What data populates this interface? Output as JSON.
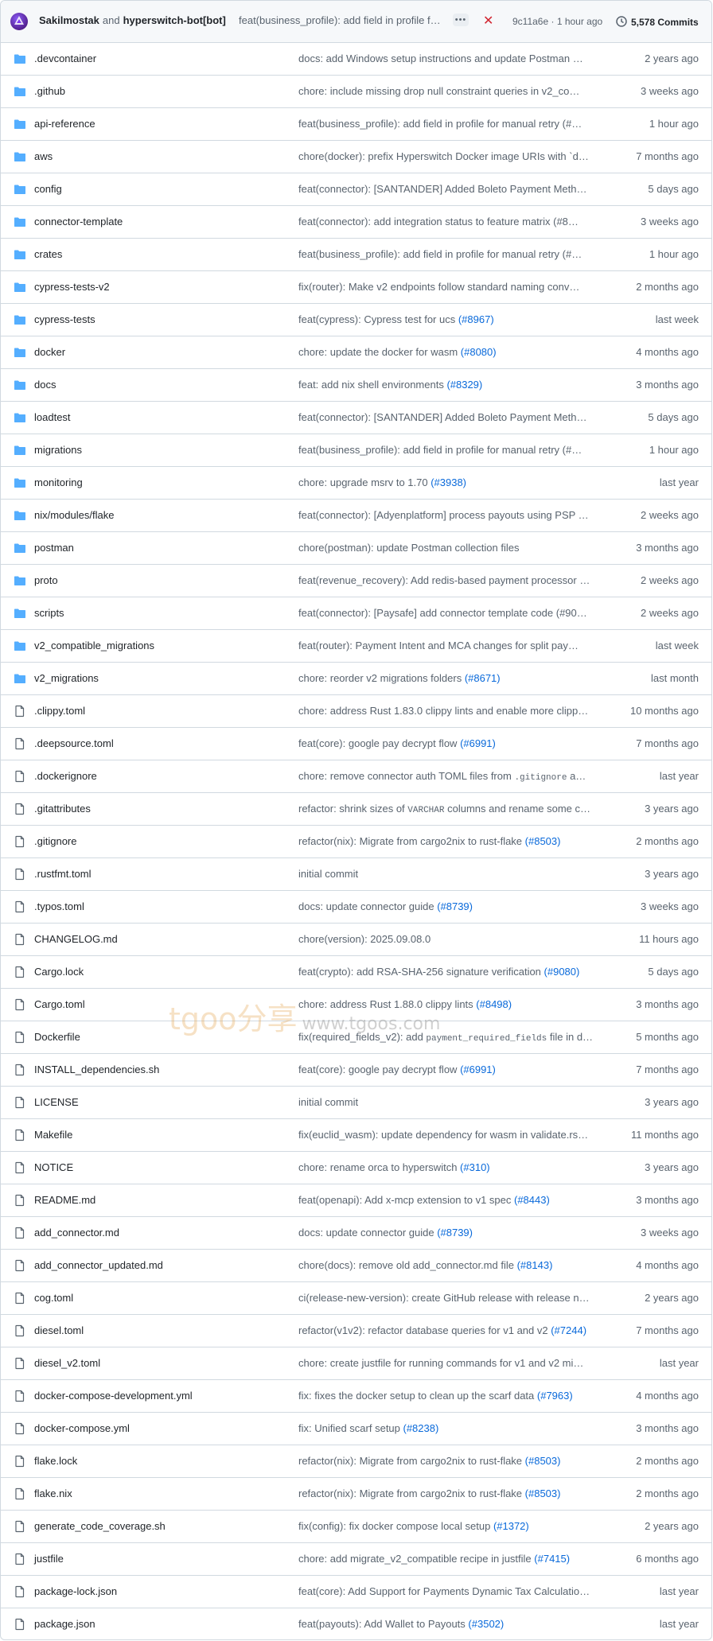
{
  "commit": {
    "author1": "Sakilmostak",
    "conjunction": "and",
    "author2": "hyperswitch-bot[bot]",
    "message": "feat(business_profile): add field in profile for manual retry",
    "dots": "•••",
    "status_icon": "x-icon",
    "status_color": "#d1242f",
    "sha_time": "9c11a6e · 1 hour ago",
    "commits_label": "5,578 Commits"
  },
  "watermark": {
    "text": "tgoo分享",
    "url": "www.tgoos.com"
  },
  "files": [
    {
      "type": "folder",
      "name": ".devcontainer",
      "msg": "docs: add Windows setup instructions and update Postman …",
      "age": "2 years ago"
    },
    {
      "type": "folder",
      "name": ".github",
      "msg": "chore: include missing drop null constraint queries in v2_co…",
      "age": "3 weeks ago"
    },
    {
      "type": "folder",
      "name": "api-reference",
      "msg": "feat(business_profile): add field in profile for manual retry (#…",
      "age": "1 hour ago"
    },
    {
      "type": "folder",
      "name": "aws",
      "msg": "chore(docker): prefix Hyperswitch Docker image URIs with `d…",
      "age": "7 months ago"
    },
    {
      "type": "folder",
      "name": "config",
      "msg": "feat(connector): [SANTANDER] Added Boleto Payment Meth…",
      "age": "5 days ago"
    },
    {
      "type": "folder",
      "name": "connector-template",
      "msg": "feat(connector): add integration status to feature matrix (#8…",
      "age": "3 weeks ago"
    },
    {
      "type": "folder",
      "name": "crates",
      "msg": "feat(business_profile): add field in profile for manual retry (#…",
      "age": "1 hour ago"
    },
    {
      "type": "folder",
      "name": "cypress-tests-v2",
      "msg": "fix(router): Make v2 endpoints follow standard naming conv…",
      "age": "2 months ago"
    },
    {
      "type": "folder",
      "name": "cypress-tests",
      "msg": "feat(cypress): Cypress test for ucs ",
      "pr": "(#8967)",
      "age": "last week"
    },
    {
      "type": "folder",
      "name": "docker",
      "msg": "chore: update the docker for wasm ",
      "pr": "(#8080)",
      "age": "4 months ago"
    },
    {
      "type": "folder",
      "name": "docs",
      "msg": "feat: add nix shell environments ",
      "pr": "(#8329)",
      "age": "3 months ago"
    },
    {
      "type": "folder",
      "name": "loadtest",
      "msg": "feat(connector): [SANTANDER] Added Boleto Payment Meth…",
      "age": "5 days ago"
    },
    {
      "type": "folder",
      "name": "migrations",
      "msg": "feat(business_profile): add field in profile for manual retry (#…",
      "age": "1 hour ago"
    },
    {
      "type": "folder",
      "name": "monitoring",
      "msg": "chore: upgrade msrv to 1.70 ",
      "pr": "(#3938)",
      "age": "last year"
    },
    {
      "type": "folder",
      "name": "nix/modules/flake",
      "msg": "feat(connector): [Adyenplatform] process payouts using PSP …",
      "age": "2 weeks ago"
    },
    {
      "type": "folder",
      "name": "postman",
      "msg": "chore(postman): update Postman collection files",
      "age": "3 months ago"
    },
    {
      "type": "folder",
      "name": "proto",
      "msg": "feat(revenue_recovery): Add redis-based payment processor …",
      "age": "2 weeks ago"
    },
    {
      "type": "folder",
      "name": "scripts",
      "msg": "feat(connector): [Paysafe] add connector template code (#90…",
      "age": "2 weeks ago"
    },
    {
      "type": "folder",
      "name": "v2_compatible_migrations",
      "msg": "feat(router): Payment Intent and MCA changes for split pay…",
      "age": "last week"
    },
    {
      "type": "folder",
      "name": "v2_migrations",
      "msg": "chore: reorder v2 migrations folders ",
      "pr": "(#8671)",
      "age": "last month"
    },
    {
      "type": "file",
      "name": ".clippy.toml",
      "msg": "chore: address Rust 1.83.0 clippy lints and enable more clipp…",
      "age": "10 months ago"
    },
    {
      "type": "file",
      "name": ".deepsource.toml",
      "msg": "feat(core): google pay decrypt flow ",
      "pr": "(#6991)",
      "age": "7 months ago"
    },
    {
      "type": "file",
      "name": ".dockerignore",
      "msg": "chore: remove connector auth TOML files from ",
      "code": ".gitignore",
      "tail": " a…",
      "age": "last year"
    },
    {
      "type": "file",
      "name": ".gitattributes",
      "msg": "refactor: shrink sizes of ",
      "code": "VARCHAR",
      "tail": " columns and rename some c…",
      "age": "3 years ago"
    },
    {
      "type": "file",
      "name": ".gitignore",
      "msg": "refactor(nix): Migrate from cargo2nix to rust-flake ",
      "pr": "(#8503)",
      "age": "2 months ago"
    },
    {
      "type": "file",
      "name": ".rustfmt.toml",
      "msg": "initial commit",
      "age": "3 years ago"
    },
    {
      "type": "file",
      "name": ".typos.toml",
      "msg": "docs: update connector guide ",
      "pr": "(#8739)",
      "age": "3 weeks ago"
    },
    {
      "type": "file",
      "name": "CHANGELOG.md",
      "msg": "chore(version): 2025.09.08.0",
      "age": "11 hours ago"
    },
    {
      "type": "file",
      "name": "Cargo.lock",
      "msg": "feat(crypto): add RSA-SHA-256 signature verification ",
      "pr": "(#9080)",
      "age": "5 days ago"
    },
    {
      "type": "file",
      "name": "Cargo.toml",
      "msg": "chore: address Rust 1.88.0 clippy lints ",
      "pr": "(#8498)",
      "age": "3 months ago"
    },
    {
      "type": "file",
      "name": "Dockerfile",
      "msg": "fix(required_fields_v2): add ",
      "code": "payment_required_fields",
      "tail": " file in d…",
      "age": "5 months ago"
    },
    {
      "type": "file",
      "name": "INSTALL_dependencies.sh",
      "msg": "feat(core): google pay decrypt flow ",
      "pr": "(#6991)",
      "age": "7 months ago"
    },
    {
      "type": "file",
      "name": "LICENSE",
      "msg": "initial commit",
      "age": "3 years ago"
    },
    {
      "type": "file",
      "name": "Makefile",
      "msg": "fix(euclid_wasm): update dependency for wasm in validate.rs…",
      "age": "11 months ago"
    },
    {
      "type": "file",
      "name": "NOTICE",
      "msg": "chore: rename orca to hyperswitch ",
      "pr": "(#310)",
      "age": "3 years ago"
    },
    {
      "type": "file",
      "name": "README.md",
      "msg": "feat(openapi): Add x-mcp extension to v1 spec ",
      "pr": "(#8443)",
      "age": "3 months ago"
    },
    {
      "type": "file",
      "name": "add_connector.md",
      "msg": "docs: update connector guide ",
      "pr": "(#8739)",
      "age": "3 weeks ago"
    },
    {
      "type": "file",
      "name": "add_connector_updated.md",
      "msg": "chore(docs): remove old add_connector.md file ",
      "pr": "(#8143)",
      "age": "4 months ago"
    },
    {
      "type": "file",
      "name": "cog.toml",
      "msg": "ci(release-new-version): create GitHub release with release n…",
      "age": "2 years ago"
    },
    {
      "type": "file",
      "name": "diesel.toml",
      "msg": "refactor(v1v2): refactor database queries for v1 and v2 ",
      "pr": "(#7244)",
      "age": "7 months ago"
    },
    {
      "type": "file",
      "name": "diesel_v2.toml",
      "msg": "chore: create justfile for running commands for v1 and v2 mi…",
      "age": "last year"
    },
    {
      "type": "file",
      "name": "docker-compose-development.yml",
      "msg": "fix: fixes the docker setup to clean up the scarf data ",
      "pr": "(#7963)",
      "age": "4 months ago"
    },
    {
      "type": "file",
      "name": "docker-compose.yml",
      "msg": "fix: Unified scarf setup ",
      "pr": "(#8238)",
      "age": "3 months ago"
    },
    {
      "type": "file",
      "name": "flake.lock",
      "msg": "refactor(nix): Migrate from cargo2nix to rust-flake ",
      "pr": "(#8503)",
      "age": "2 months ago"
    },
    {
      "type": "file",
      "name": "flake.nix",
      "msg": "refactor(nix): Migrate from cargo2nix to rust-flake ",
      "pr": "(#8503)",
      "age": "2 months ago"
    },
    {
      "type": "file",
      "name": "generate_code_coverage.sh",
      "msg": "fix(config): fix docker compose local setup ",
      "pr": "(#1372)",
      "age": "2 years ago"
    },
    {
      "type": "file",
      "name": "justfile",
      "msg": "chore: add migrate_v2_compatible recipe in justfile ",
      "pr": "(#7415)",
      "age": "6 months ago"
    },
    {
      "type": "file",
      "name": "package-lock.json",
      "msg": "feat(core): Add Support for Payments Dynamic Tax Calculatio…",
      "age": "last year"
    },
    {
      "type": "file",
      "name": "package.json",
      "msg": "feat(payouts): Add Wallet to Payouts ",
      "pr": "(#3502)",
      "age": "last year"
    }
  ]
}
